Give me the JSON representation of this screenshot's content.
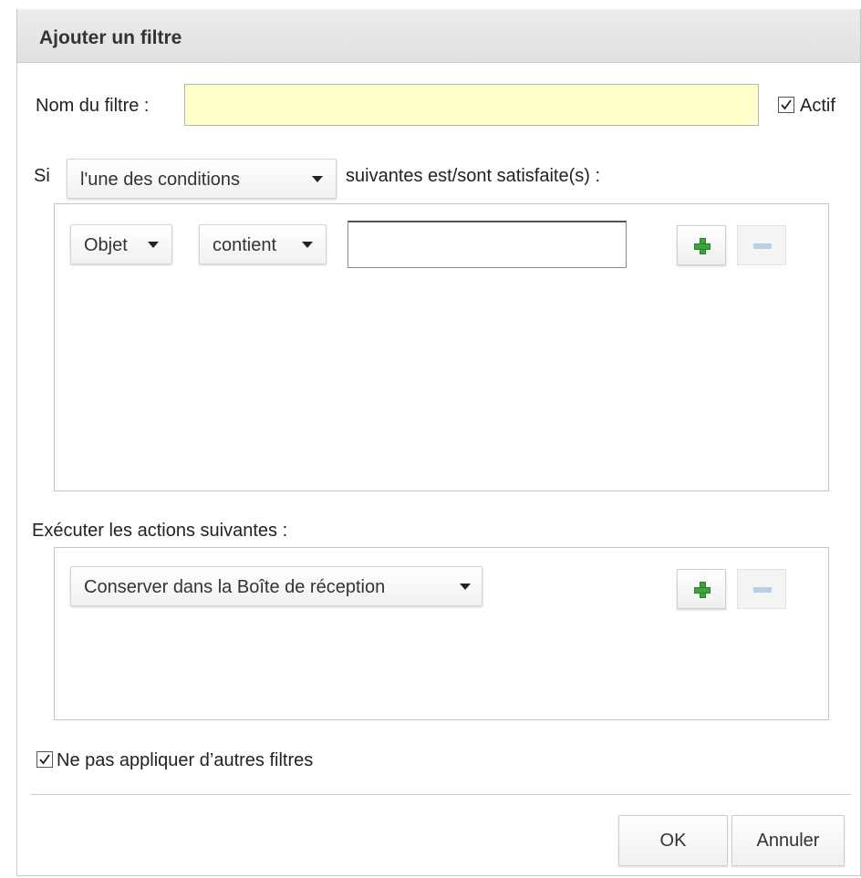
{
  "dialog": {
    "title": "Ajouter un filtre",
    "name_label": "Nom du filtre :",
    "name_value": "",
    "active_label": "Actif",
    "active_checked": true,
    "conditions": {
      "prefix": "Si",
      "match_mode": "l'une des conditions",
      "suffix": "suivantes est/sont satisfaite(s) :",
      "rows": [
        {
          "field": "Objet",
          "operator": "contient",
          "value": ""
        }
      ]
    },
    "actions": {
      "label": "Exécuter les actions suivantes :",
      "rows": [
        {
          "action": "Conserver dans la Boîte de réception"
        }
      ]
    },
    "stop_label": "Ne pas appliquer d’autres filtres",
    "stop_checked": true,
    "ok_label": "OK",
    "cancel_label": "Annuler"
  },
  "icons": {
    "add": "plus-icon",
    "remove": "minus-icon",
    "dropdown": "caret-down-icon",
    "check": "checkmark-icon"
  },
  "colors": {
    "name_input_bg": "#ffffcc",
    "add_icon": "#3aa53a",
    "remove_icon": "#b9cfe3"
  }
}
